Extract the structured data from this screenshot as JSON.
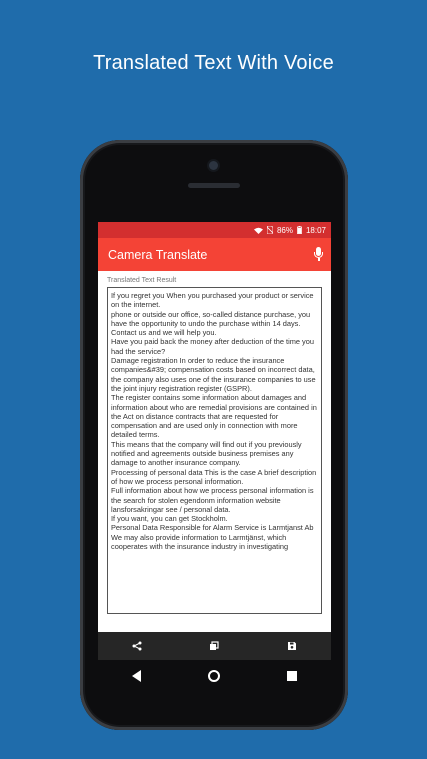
{
  "headline": "Translated Text With Voice",
  "status": {
    "wifi_icon": "wifi-icon",
    "sim_icon": "no-sim-icon",
    "battery": "86%",
    "time": "18:07"
  },
  "appbar": {
    "title": "Camera Translate",
    "mic_icon": "microphone-icon"
  },
  "section_label": "Translated Text Result",
  "translated_lines": [
    "If you regret you When you purchased your product or service on the internet.",
    "phone or outside our office, so-called distance purchase, you have the opportunity to undo the purchase within 14 days.",
    "Contact us and we will help you.",
    "Have you paid back the money after deduction of the time you had the service?",
    "Damage registration In order to reduce the insurance companies&#39; compensation costs based on incorrect data, the company also uses one of the insurance companies to use the joint injury registration register (GSPR).",
    "The register contains some information about damages and information about who are remedial provisions are contained in the Act on distance contracts that are requested for compensation and are used only in connection with more detailed terms.",
    "This means that the company will find out if you previously notified and agreements outside business premises any damage to another insurance company.",
    "Processing of personal data This is the case A brief description of how we process personal information.",
    "Full information about how we process personal information is the search for stolen egendonm information website lansforsakringar see / personal data.",
    "If you want, you can get Stockholm.",
    "Personal Data Responsible for Alarm Service is Larmtjanst Ab We may also provide information to Larmtjänst, which cooperates with the insurance industry in investigating"
  ],
  "nav_inner": {
    "share_icon": "share-icon",
    "copy_icon": "copy-icon",
    "save_icon": "save-icon"
  },
  "nav_outer": {
    "back_icon": "back-triangle-icon",
    "home_icon": "home-circle-icon",
    "recents_icon": "recents-square-icon"
  }
}
